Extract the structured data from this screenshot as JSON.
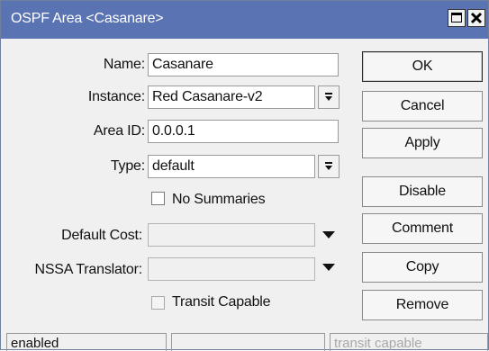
{
  "window": {
    "title": "OSPF Area <Casanare>",
    "titlebar_color": "#5a73b3",
    "controls": [
      "maximize-icon",
      "close-icon"
    ]
  },
  "form": {
    "name_label": "Name:",
    "name_value": "Casanare",
    "instance_label": "Instance:",
    "instance_value": "Red Casanare-v2",
    "area_id_label": "Area ID:",
    "area_id_value": "0.0.0.1",
    "type_label": "Type:",
    "type_value": "default",
    "no_summaries_label": "No Summaries",
    "default_cost_label": "Default Cost:",
    "default_cost_value": "",
    "nssa_translator_label": "NSSA Translator:",
    "nssa_translator_value": "",
    "transit_capable_label": "Transit Capable"
  },
  "buttons": {
    "ok": "OK",
    "cancel": "Cancel",
    "apply": "Apply",
    "disable": "Disable",
    "comment": "Comment",
    "copy": "Copy",
    "remove": "Remove"
  },
  "statusbar": {
    "state": "enabled",
    "middle": "",
    "transit": "transit capable"
  }
}
